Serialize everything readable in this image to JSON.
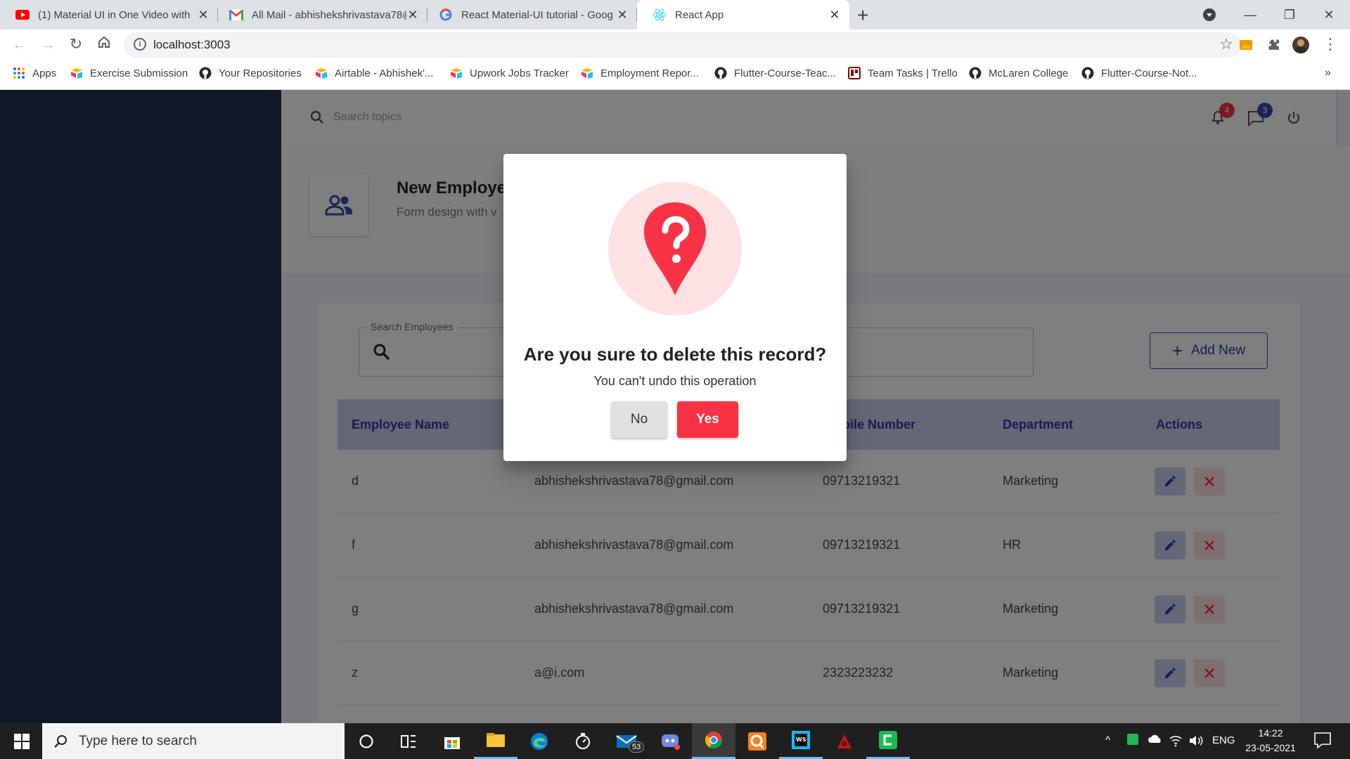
{
  "browser": {
    "tabs": [
      {
        "title": "(1) Material UI in One Video with",
        "icon": "youtube-icon"
      },
      {
        "title": "All Mail - abhishekshrivastava78@",
        "icon": "gmail-icon"
      },
      {
        "title": "React Material-UI tutorial - Goog",
        "icon": "google-icon"
      },
      {
        "title": "React App",
        "icon": "react-icon"
      }
    ],
    "url": "localhost:3003",
    "bookmarks": [
      "Apps",
      "Exercise Submission",
      "Your Repositories",
      "Airtable - Abhishek'...",
      "Upwork Jobs Tracker",
      "Employment Repor...",
      "Flutter-Course-Teac...",
      "Team Tasks | Trello",
      "McLaren College",
      "Flutter-Course-Not..."
    ]
  },
  "header": {
    "search_placeholder": "Search topics",
    "notifications_count": "4",
    "messages_count": "3"
  },
  "page": {
    "title": "New Employe",
    "subtitle": "Form design with v"
  },
  "employees": {
    "search_label": "Search Employees",
    "add_new_label": "Add New",
    "columns": {
      "name": "Employee Name",
      "mobile": "bile Number",
      "department": "Department",
      "actions": "Actions"
    },
    "rows": [
      {
        "name": "d",
        "email": "abhishekshrivastava78@gmail.com",
        "mobile": "09713219321",
        "department": "Marketing"
      },
      {
        "name": "f",
        "email": "abhishekshrivastava78@gmail.com",
        "mobile": "09713219321",
        "department": "HR"
      },
      {
        "name": "g",
        "email": "abhishekshrivastava78@gmail.com",
        "mobile": "09713219321",
        "department": "Marketing"
      },
      {
        "name": "z",
        "email": "a@i.com",
        "mobile": "2323223232",
        "department": "Marketing"
      }
    ]
  },
  "dialog": {
    "title": "Are you sure to delete this record?",
    "subtitle": "You can't undo this operation",
    "no_label": "No",
    "yes_label": "Yes"
  },
  "taskbar": {
    "search_placeholder": "Type here to search",
    "mail_badge": "53",
    "language": "ENG",
    "time": "14:22",
    "date": "23-05-2021"
  },
  "colors": {
    "primary": "#333996",
    "danger": "#f83245",
    "sidebar": "#253053"
  }
}
